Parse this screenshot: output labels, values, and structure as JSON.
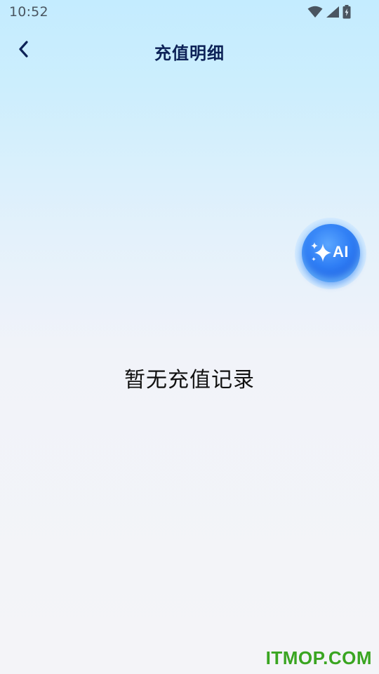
{
  "status_bar": {
    "time": "10:52",
    "icons": [
      "wifi-icon",
      "cellular-signal-icon",
      "battery-charging-icon"
    ]
  },
  "header": {
    "back_icon": "chevron-left-icon",
    "title": "充值明细"
  },
  "ai_button": {
    "icon": "sparkle-icon",
    "label": "AI"
  },
  "empty_state": {
    "message": "暂无充值记录"
  },
  "watermark": {
    "text": "ITMOP.COM"
  },
  "colors": {
    "title": "#0d2257",
    "accent": "#2f7ef5",
    "watermark": "#3aa521",
    "status_text": "#4a5560"
  }
}
